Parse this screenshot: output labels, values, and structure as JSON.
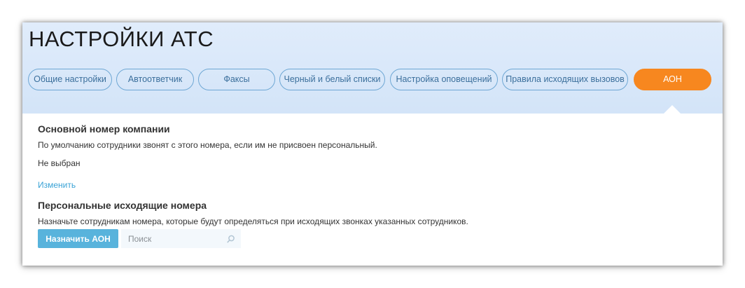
{
  "page": {
    "title": "НАСТРОЙКИ АТС"
  },
  "tabs": [
    {
      "label": "Общие настройки",
      "active": false
    },
    {
      "label": "Автоответчик",
      "active": false
    },
    {
      "label": "Факсы",
      "active": false
    },
    {
      "label": "Черный и белый списки",
      "active": false
    },
    {
      "label": "Настройка оповещений",
      "active": false
    },
    {
      "label": "Правила исходящих вызовов",
      "active": false
    },
    {
      "label": "АОН",
      "active": true
    }
  ],
  "main_number": {
    "title": "Основной номер компании",
    "description": "По умолчанию сотрудники звонят с этого номера, если им не присвоен персональный.",
    "value": "Не выбран",
    "change_link": "Изменить"
  },
  "personal_numbers": {
    "title": "Персональные исходящие номера",
    "description": "Назначьте сотрудникам номера, которые будут определяться при исходящих звонках указанных сотрудников.",
    "assign_button": "Назначить АОН",
    "search_placeholder": "Поиск"
  },
  "icons": {
    "search": "search-icon"
  },
  "colors": {
    "active_tab": "#f7871f",
    "tab_border": "#6ea7d4",
    "tab_text": "#3b6f9c",
    "header_bg": "#d8e7f9",
    "link": "#3aa3d6",
    "button": "#58b3dc"
  }
}
